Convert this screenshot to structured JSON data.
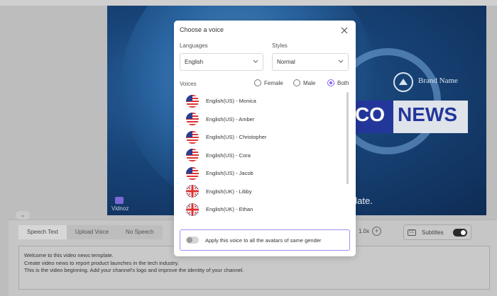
{
  "background": {
    "brand_name": "Brand Name",
    "news_a": "CO",
    "news_b": "NEWS",
    "caption": "plate.",
    "watermark": "Vidnoz",
    "tabs": [
      "Speech Text",
      "Upload Voice",
      "No Speech"
    ],
    "speed": "1.0x",
    "subtitles_label": "Subtitles",
    "cc_label": "CC",
    "script_lines": [
      "Welcome to this video news template.",
      "Create video news to report product launches in the tech industry.",
      "This is the video beginning. Add your channel's logo and improve the identity of your channel."
    ]
  },
  "modal": {
    "title": "Choose a voice",
    "languages_label": "Languages",
    "language_value": "English",
    "styles_label": "Styles",
    "style_value": "Normal",
    "voices_label": "Voices",
    "gender_options": [
      "Female",
      "Male",
      "Both"
    ],
    "selected_gender": "Both",
    "voices": [
      {
        "name": "English(US) - Monica",
        "flag": "us-flag-icon"
      },
      {
        "name": "English(US) - Amber",
        "flag": "us-flag-icon"
      },
      {
        "name": "English(US) - Christopher",
        "flag": "us-flag-icon"
      },
      {
        "name": "English(US) - Cora",
        "flag": "us-flag-icon"
      },
      {
        "name": "English(US) - Jacob",
        "flag": "us-flag-icon"
      },
      {
        "name": "English(UK) - Libby",
        "flag": "uk-flag-icon"
      },
      {
        "name": "English(UK) - Ethan",
        "flag": "uk-flag-icon"
      }
    ],
    "apply_text": "Apply this voice to all the avatars of same gender"
  },
  "colors": {
    "accent": "#8b5cf6",
    "news_blue": "#23379b"
  }
}
